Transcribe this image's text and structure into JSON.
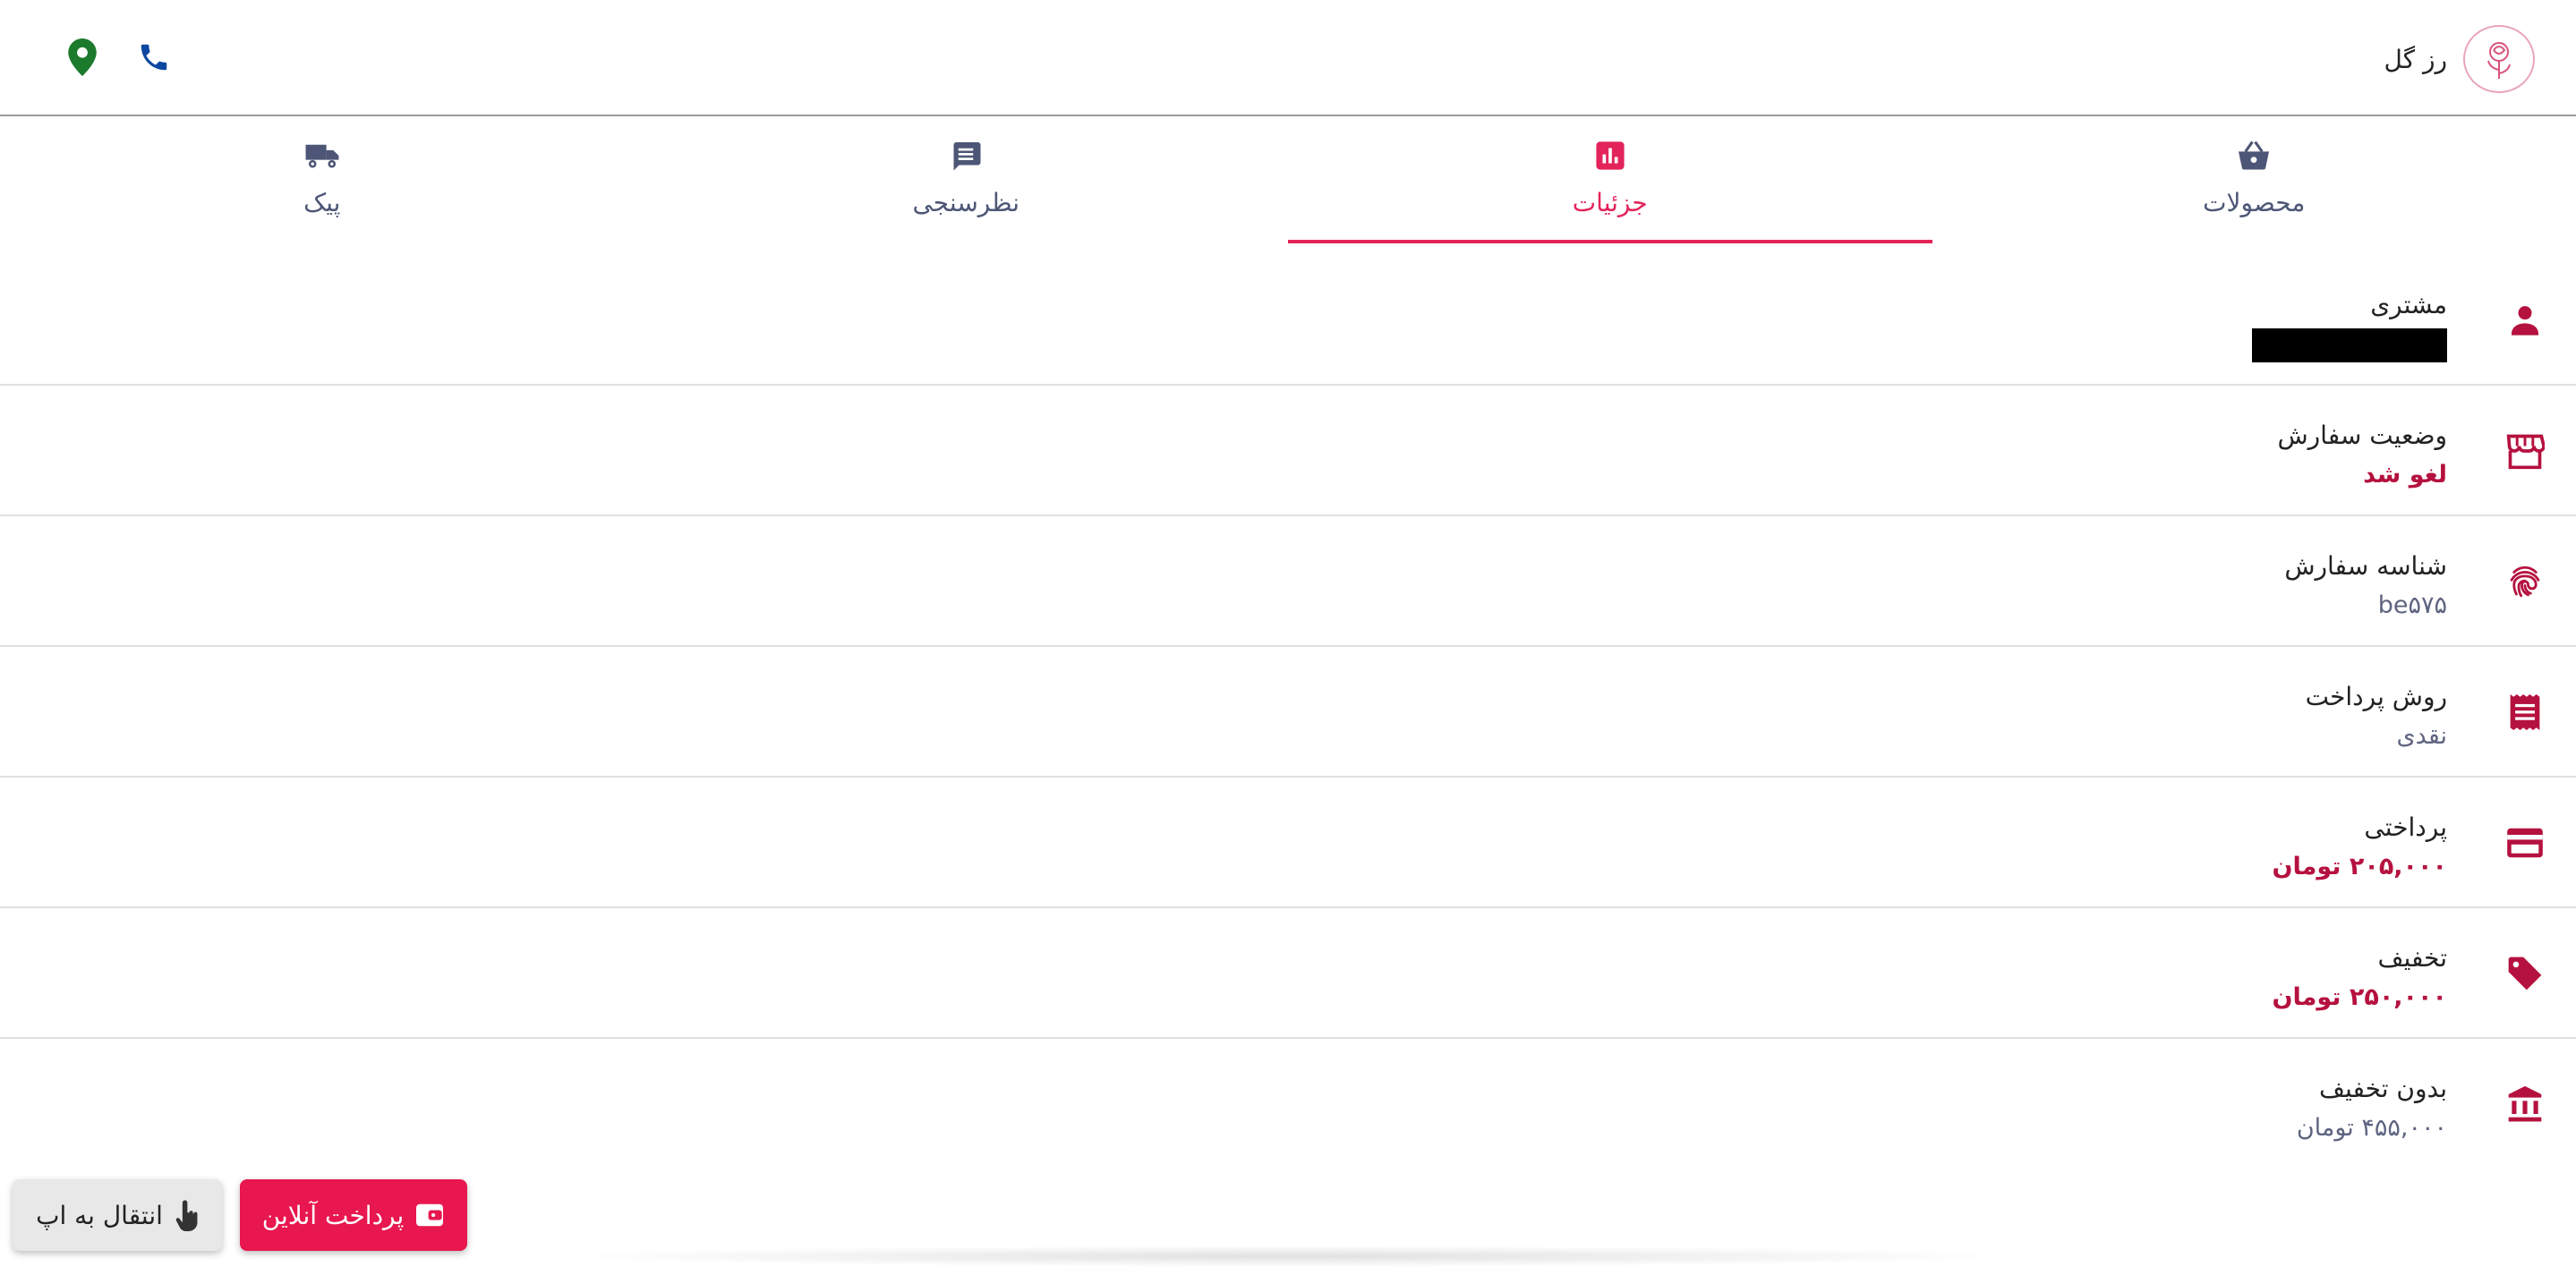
{
  "header": {
    "brand_name": "رز گل",
    "logo_icon": "rose-logo",
    "phone_icon": "phone-icon",
    "location_icon": "location-pin-icon",
    "colors": {
      "phone": "#0d47a1",
      "location": "#1b7a2c"
    }
  },
  "tabs": [
    {
      "label": "محصولات",
      "icon": "basket-icon",
      "active": false
    },
    {
      "label": "جزئیات",
      "icon": "chart-icon",
      "active": true
    },
    {
      "label": "نظرسنجی",
      "icon": "comment-icon",
      "active": false
    },
    {
      "label": "پیک",
      "icon": "truck-icon",
      "active": false
    }
  ],
  "details": {
    "customer": {
      "label": "مشتری",
      "value": "",
      "redacted": true
    },
    "order_status": {
      "label": "وضعیت سفارش",
      "value": "لغو شد"
    },
    "order_id": {
      "label": "شناسه سفارش",
      "value": "be۵۷۵"
    },
    "payment_method": {
      "label": "روش پرداخت",
      "value": "نقدی"
    },
    "payable": {
      "label": "پرداختی",
      "value": "۲۰۵,۰۰۰ تومان"
    },
    "discount": {
      "label": "تخفیف",
      "value": "۲۵۰,۰۰۰ تومان"
    },
    "without_discount": {
      "label": "بدون تخفیف",
      "value": "۴۵۵,۰۰۰ تومان"
    }
  },
  "actions": {
    "online_payment_label": "پرداخت آنلاین",
    "open_app_label": "انتقال به اپ"
  },
  "colors": {
    "accent": "#e3245a",
    "accent_dark": "#b5113f",
    "tab_text": "#4d5676",
    "muted_value": "#5e6480"
  }
}
